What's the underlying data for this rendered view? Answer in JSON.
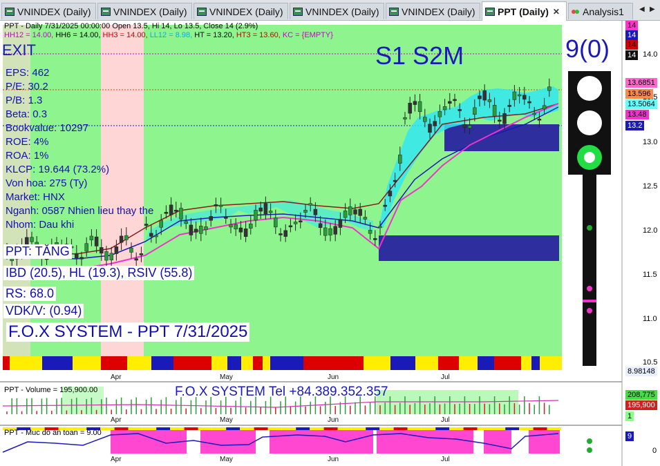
{
  "tabs": [
    {
      "label": "VNINDEX (Daily)",
      "active": false
    },
    {
      "label": "VNINDEX (Daily)",
      "active": false
    },
    {
      "label": "VNINDEX (Daily)",
      "active": false
    },
    {
      "label": "VNINDEX (Daily)",
      "active": false
    },
    {
      "label": "VNINDEX (Daily)",
      "active": false
    },
    {
      "label": "PPT (Daily)",
      "active": true
    },
    {
      "label": "Analysis1",
      "active": false
    }
  ],
  "header": {
    "line1": "PPT - Daily 7/31/2025 00:00:00 Open 13.5, Hi 14, Lo 13.5, Close 14 (2.9%)",
    "line2": [
      {
        "text": "HH12 = 14.00, ",
        "color": "#cc00cc"
      },
      {
        "text": "HH6 = 14.00, ",
        "color": "#000000"
      },
      {
        "text": "HH3 = 14.00, ",
        "color": "#cc0000"
      },
      {
        "text": "LL12 = 8.98, ",
        "color": "#00aaff"
      },
      {
        "text": "HT  = 13.20, ",
        "color": "#000000"
      },
      {
        "text": "HT3  = 13.60, ",
        "color": "#cc0000"
      },
      {
        "text": "KC = {EMPTY}",
        "color": "#cc00cc"
      }
    ]
  },
  "overlay": {
    "exit": "EXIT",
    "fundamentals": [
      "EPS: 462",
      "P/E: 30.2",
      "P/B: 1.3",
      "Beta: 0.3",
      "Bookvalue: 10297",
      "ROE: 4%",
      "ROA: 1%",
      "KLCP: 19.644 (73.2%)",
      "Von hoa: 275 (Ty)",
      "Market: HNX",
      "Nganh: 0587 Nhien lieu thay the",
      "Nhom: Dau khi"
    ],
    "status": "PPT: TĂNG",
    "ibd": "IBD (20.5), HL (19.3), RSIV (55.8)",
    "rs": "RS: 68.0",
    "vdk": "VDK/V:  (0.94)",
    "system": "F.O.X SYSTEM - PPT 7/31/2025",
    "signal": "S1  S2M",
    "count": "9(0)",
    "tel": "F.O.X SYSTEM Tel +84.389.352.357"
  },
  "price_axis": {
    "labels": [
      "14.0",
      "13.5",
      "13.0",
      "12.5",
      "12.0",
      "11.5",
      "11.0",
      "10.5"
    ],
    "top_badges": [
      {
        "text": "14",
        "bg": "#ff33cc",
        "fg": "#000000"
      },
      {
        "text": "14",
        "bg": "#1a1ab8",
        "fg": "#ffffff"
      },
      {
        "text": "14",
        "bg": "#cc0000",
        "fg": "#000000"
      },
      {
        "text": "14",
        "bg": "#111111",
        "fg": "#ffffff"
      }
    ],
    "mid_badges": [
      {
        "text": "13.6851",
        "bg": "#ff66cc",
        "fg": "#000000"
      },
      {
        "text": "13.596",
        "bg": "#ff8844",
        "fg": "#000000"
      },
      {
        "text": "13.5064",
        "bg": "#66ffff",
        "fg": "#000000"
      },
      {
        "text": "13.48",
        "bg": "#ee33cc",
        "fg": "#000000"
      },
      {
        "text": "13.2",
        "bg": "#1a1ab8",
        "fg": "#ffffff"
      }
    ],
    "low_badge": {
      "text": "8.98148",
      "bg": "#e8f0ff",
      "fg": "#000000"
    }
  },
  "months": [
    "Apr",
    "May",
    "Jun",
    "Jul"
  ],
  "volume": {
    "title": "PPT - Volume = 195,900.00",
    "badges": [
      {
        "text": "208,775",
        "bg": "#44dd44",
        "fg": "#000000"
      },
      {
        "text": "195,900",
        "bg": "#cc2222",
        "fg": "#ffffff"
      },
      {
        "text": "1",
        "bg": "#88ff88",
        "fg": "#000000"
      }
    ]
  },
  "safety": {
    "title": "PPT - Muc do an toan = 9.00",
    "badge": {
      "text": "9",
      "bg": "#1a1ab8",
      "fg": "#ffffff"
    },
    "zero": "0"
  },
  "colors": {
    "chart_bg": "#8ef58e",
    "pink_zone": "#ffd6d6",
    "zone_blue": "#2e2e9e",
    "accent": "#1a1ab8"
  }
}
